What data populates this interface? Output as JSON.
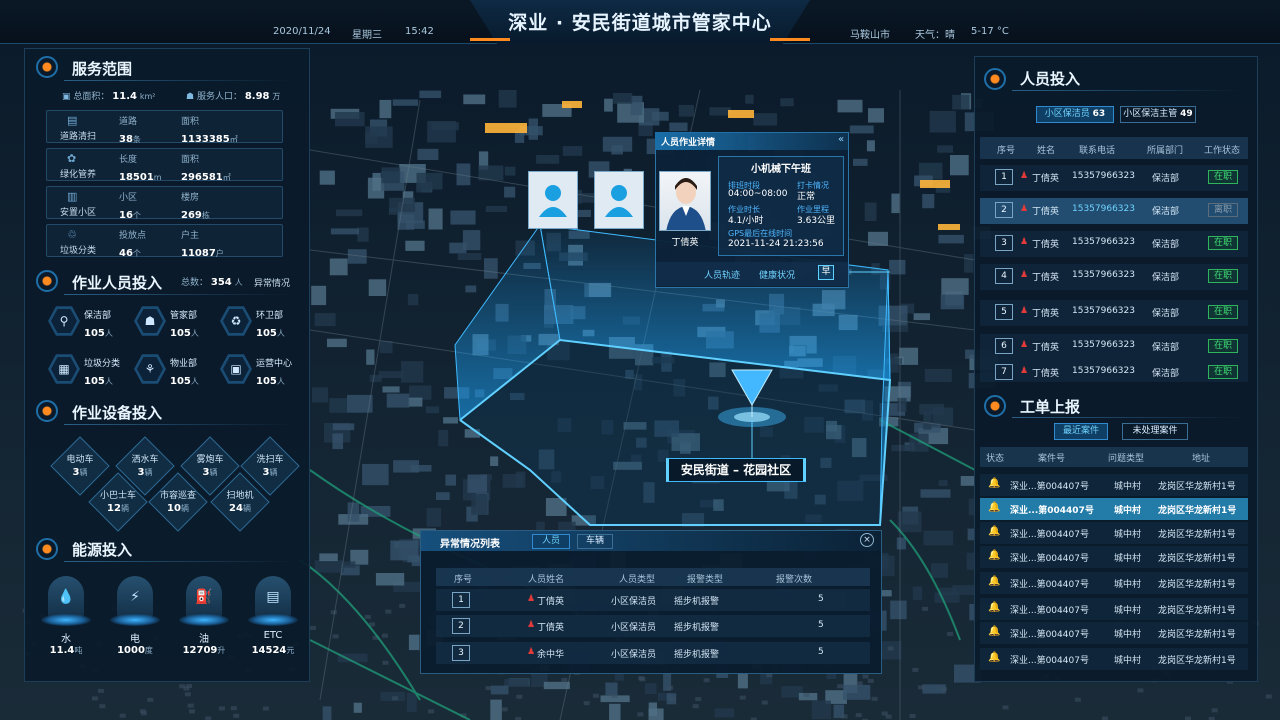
{
  "header": {
    "date": "2020/11/24",
    "weekday": "星期三",
    "time": "15:42",
    "title": "深业 · 安民街道城市管家中心",
    "city": "马鞍山市",
    "weather_label": "天气：晴",
    "temp": "5-17 °C"
  },
  "service": {
    "title": "服务范围",
    "area_label": "总面积：",
    "area_value": "11.4",
    "area_unit": "km²",
    "pop_label": "服务人口：",
    "pop_value": "8.98",
    "pop_unit": "万",
    "rows": [
      {
        "name": "道路清扫",
        "l1": "道路",
        "v1": "38",
        "u1": "条",
        "l2": "面积",
        "v2": "1133385",
        "u2": "㎡"
      },
      {
        "name": "绿化管养",
        "l1": "长度",
        "v1": "18501",
        "u1": "m",
        "l2": "面积",
        "v2": "296581",
        "u2": "㎡"
      },
      {
        "name": "安置小区",
        "l1": "小区",
        "v1": "16",
        "u1": "个",
        "l2": "楼房",
        "v2": "269",
        "u2": "栋"
      },
      {
        "name": "垃圾分类",
        "l1": "投放点",
        "v1": "46",
        "u1": "个",
        "l2": "户主",
        "v2": "11087",
        "u2": "户"
      }
    ]
  },
  "staff": {
    "title": "作业人员投入",
    "total_label": "总数：",
    "total_value": "354",
    "total_unit": "人",
    "abnormal": "异常情况",
    "items": [
      {
        "name": "保洁部",
        "count": "105",
        "unit": "人",
        "icon": "cleaner-icon",
        "glyph": "⚲"
      },
      {
        "name": "管家部",
        "count": "105",
        "unit": "人",
        "icon": "butler-icon",
        "glyph": "☗"
      },
      {
        "name": "环卫部",
        "count": "105",
        "unit": "人",
        "icon": "recycle-icon",
        "glyph": "♻"
      },
      {
        "name": "垃圾分类",
        "count": "105",
        "unit": "人",
        "icon": "sorting-icon",
        "glyph": "▦"
      },
      {
        "name": "物业部",
        "count": "105",
        "unit": "人",
        "icon": "property-icon",
        "glyph": "⚘"
      },
      {
        "name": "运营中心",
        "count": "105",
        "unit": "人",
        "icon": "operation-icon",
        "glyph": "▣"
      }
    ]
  },
  "equipment": {
    "title": "作业设备投入",
    "items": [
      {
        "name": "电动车",
        "count": "3",
        "unit": "辆"
      },
      {
        "name": "洒水车",
        "count": "3",
        "unit": "辆"
      },
      {
        "name": "雾炮车",
        "count": "3",
        "unit": "辆"
      },
      {
        "name": "洗扫车",
        "count": "3",
        "unit": "辆"
      },
      {
        "name": "小巴士车",
        "count": "12",
        "unit": "辆"
      },
      {
        "name": "市容巡查",
        "count": "10",
        "unit": "辆"
      },
      {
        "name": "扫地机",
        "count": "24",
        "unit": "辆"
      }
    ]
  },
  "energy": {
    "title": "能源投入",
    "items": [
      {
        "name": "水",
        "value": "11.4",
        "unit": "吨",
        "icon": "water-icon",
        "glyph": "💧"
      },
      {
        "name": "电",
        "value": "1000",
        "unit": "度",
        "icon": "electric-icon",
        "glyph": "⚡"
      },
      {
        "name": "油",
        "value": "12709",
        "unit": "升",
        "icon": "oil-icon",
        "glyph": "⛽"
      },
      {
        "name": "ETC",
        "value": "14524",
        "unit": "元",
        "icon": "etc-icon",
        "glyph": "▤"
      }
    ]
  },
  "personnel": {
    "title": "人员投入",
    "tab1_label": "小区保洁员",
    "tab1_count": "63",
    "tab2_label": "小区保洁主管",
    "tab2_count": "49",
    "columns": [
      "序号",
      "姓名",
      "联系电话",
      "所属部门",
      "工作状态"
    ],
    "rows": [
      {
        "no": "1",
        "name": "丁倩英",
        "phone": "15357966323",
        "dept": "保洁部",
        "status": "在职",
        "ok": true
      },
      {
        "no": "2",
        "name": "丁倩英",
        "phone": "15357966323",
        "dept": "保洁部",
        "status": "离职",
        "ok": false
      },
      {
        "no": "3",
        "name": "丁倩英",
        "phone": "15357966323",
        "dept": "保洁部",
        "status": "在职",
        "ok": true
      },
      {
        "no": "4",
        "name": "丁倩英",
        "phone": "15357966323",
        "dept": "保洁部",
        "status": "在职",
        "ok": true
      },
      {
        "no": "5",
        "name": "丁倩英",
        "phone": "15357966323",
        "dept": "保洁部",
        "status": "在职",
        "ok": true
      },
      {
        "no": "6",
        "name": "丁倩英",
        "phone": "15357966323",
        "dept": "保洁部",
        "status": "在职",
        "ok": true
      },
      {
        "no": "7",
        "name": "丁倩英",
        "phone": "15357966323",
        "dept": "保洁部",
        "status": "在职",
        "ok": true
      }
    ]
  },
  "workorder": {
    "title": "工单上报",
    "tab1": "最近案件",
    "tab2": "未处理案件",
    "columns": [
      "状态",
      "案件号",
      "问题类型",
      "地址"
    ],
    "rows": [
      {
        "case": "深业...第004407号",
        "type": "城中村",
        "addr": "龙岗区华龙新村1号",
        "bell": "#ffae1f"
      },
      {
        "case": "深业...第004407号",
        "type": "城中村",
        "addr": "龙岗区华龙新村1号",
        "bell": "#ffae1f"
      },
      {
        "case": "深业...第004407号",
        "type": "城中村",
        "addr": "龙岗区华龙新村1号",
        "bell": "#ffae1f"
      },
      {
        "case": "深业...第004407号",
        "type": "城中村",
        "addr": "龙岗区华龙新村1号",
        "bell": "#ffae1f"
      },
      {
        "case": "深业...第004407号",
        "type": "城中村",
        "addr": "龙岗区华龙新村1号",
        "bell": "#ff3b30"
      },
      {
        "case": "深业...第004407号",
        "type": "城中村",
        "addr": "龙岗区华龙新村1号",
        "bell": "#ffae1f"
      },
      {
        "case": "深业...第004407号",
        "type": "城中村",
        "addr": "龙岗区华龙新村1号",
        "bell": "#ffae1f"
      },
      {
        "case": "深业...第004407号",
        "type": "城中村",
        "addr": "龙岗区华龙新村1号",
        "bell": "#ff3b30"
      }
    ]
  },
  "popup": {
    "title": "人员作业详情",
    "shift": "小机械下午班",
    "shift_time_label": "排班时段",
    "shift_time": "04:00~08:00",
    "punch_label": "打卡情况",
    "punch": "正常",
    "duration_label": "作业时长",
    "duration": "4.1/小时",
    "mileage_label": "作业里程",
    "mileage": "3.63公里",
    "gps_label": "GPS最后在线时间",
    "gps": "2021-11-24 21:23:56",
    "person": "丁倩英",
    "btn_track": "人员轨迹",
    "btn_health": "健康状况",
    "badge": "早"
  },
  "map": {
    "location_label": "安民街道 – 花园社区"
  },
  "abnormal": {
    "title": "异常情况列表",
    "tab_person": "人员",
    "tab_vehicle": "车辆",
    "columns": [
      "序号",
      "人员姓名",
      "人员类型",
      "报警类型",
      "报警次数"
    ],
    "rows": [
      {
        "no": "1",
        "name": "丁倩英",
        "type": "小区保洁员",
        "alarm": "摇步机报警",
        "count": "5"
      },
      {
        "no": "2",
        "name": "丁倩英",
        "type": "小区保洁员",
        "alarm": "摇步机报警",
        "count": "5"
      },
      {
        "no": "3",
        "name": "余中华",
        "type": "小区保洁员",
        "alarm": "摇步机报警",
        "count": "5"
      }
    ]
  },
  "colors": {
    "accent": "#2f8ad0",
    "ok": "#3fdd74",
    "warn": "#ffae1f",
    "alert": "#ff3b30",
    "person_red": "#e23a3a"
  }
}
